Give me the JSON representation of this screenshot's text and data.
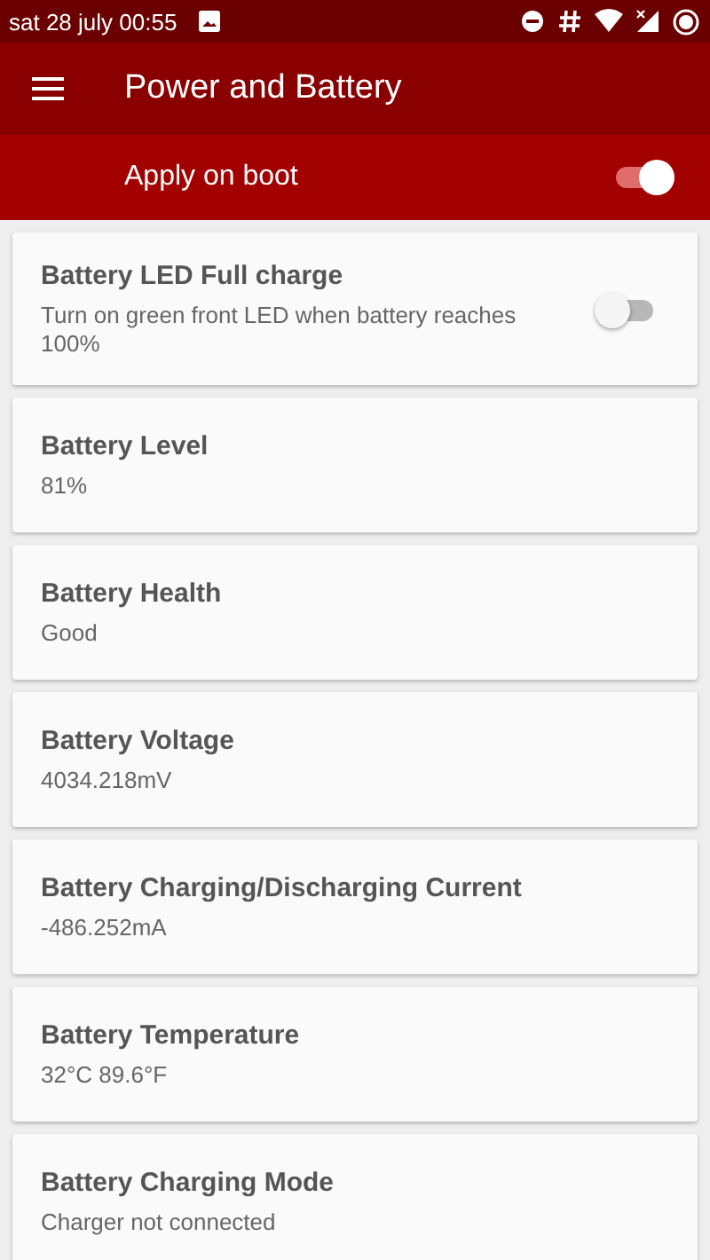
{
  "status_bar": {
    "time": "sat 28 july 00:55"
  },
  "toolbar": {
    "title": "Power and Battery"
  },
  "apply_on_boot": {
    "label": "Apply on boot",
    "on": true
  },
  "cards": [
    {
      "kind": "switch",
      "title": "Battery LED Full charge",
      "subtitle": "Turn on green front LED when battery reaches 100%",
      "on": false
    },
    {
      "kind": "info",
      "title": "Battery Level",
      "subtitle": "81%"
    },
    {
      "kind": "info",
      "title": "Battery Health",
      "subtitle": "Good"
    },
    {
      "kind": "info",
      "title": "Battery Voltage",
      "subtitle": "4034.218mV"
    },
    {
      "kind": "info",
      "title": "Battery Charging/Discharging Current",
      "subtitle": "-486.252mA"
    },
    {
      "kind": "info",
      "title": "Battery Temperature",
      "subtitle": "32°C 89.6°F"
    },
    {
      "kind": "info",
      "title": "Battery Charging Mode",
      "subtitle": "Charger not connected"
    }
  ]
}
